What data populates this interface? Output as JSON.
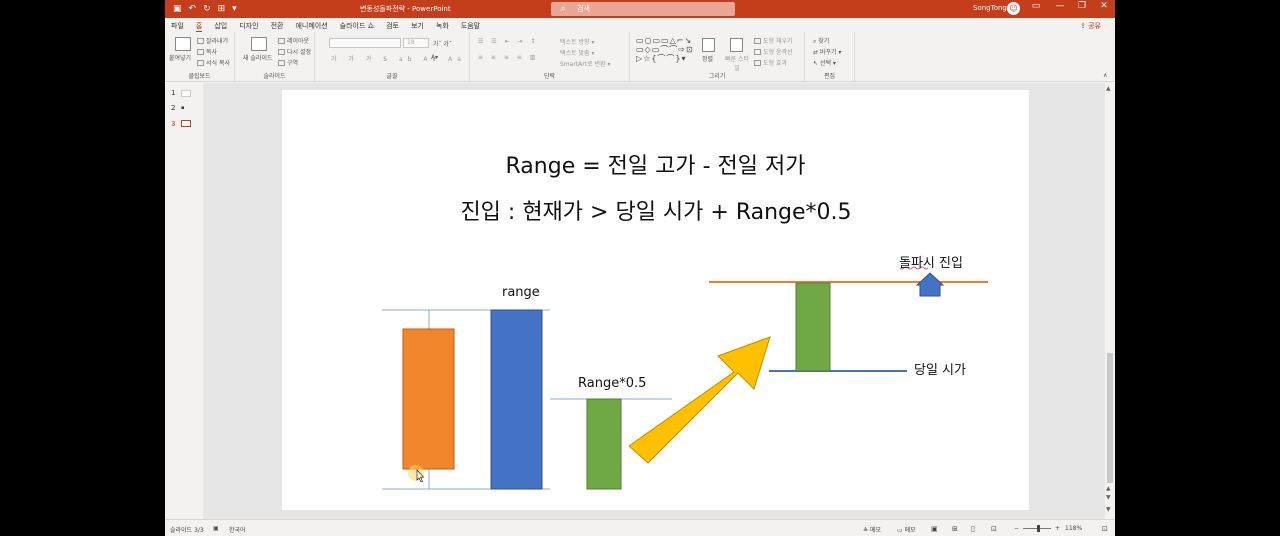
{
  "titlebar": {
    "doc_title": "변동성돌파전략  -  PowerPoint",
    "search_placeholder": "검색",
    "user_name": "SongTong",
    "avatar_initial": "☺",
    "minimize": "—",
    "restore": "❐",
    "close": "✕"
  },
  "tabs": [
    "파일",
    "홈",
    "삽입",
    "디자인",
    "전환",
    "애니메이션",
    "슬라이드 쇼",
    "검토",
    "보기",
    "녹화",
    "도움말"
  ],
  "active_tab": "홈",
  "share_label": "공유",
  "ribbon": {
    "clipboard": {
      "label": "클립보드",
      "paste": "붙여넣기",
      "cut": "잘라내기",
      "copy": "복사",
      "format_painter": "서식 복사"
    },
    "slides": {
      "label": "슬라이드",
      "new_slide": "새 슬라이드",
      "layout": "레이아웃",
      "reset": "다시 설정",
      "section": "구역"
    },
    "font": {
      "label": "글꼴",
      "font_size": "18"
    },
    "paragraph": {
      "label": "단락",
      "text_direction": "텍스트 방향",
      "align_text": "텍스트 맞춤",
      "smartart": "SmartArt로 변환"
    },
    "drawing": {
      "label": "그리기",
      "arrange": "정렬",
      "quick_styles": "빠른 스타일",
      "shape_fill": "도형 채우기",
      "shape_outline": "도형 윤곽선",
      "shape_effects": "도형 효과"
    },
    "editing": {
      "label": "편집",
      "find": "찾기",
      "replace": "바꾸기",
      "select": "선택"
    }
  },
  "thumbs": [
    {
      "num": "1"
    },
    {
      "num": "2"
    },
    {
      "num": "3"
    }
  ],
  "slide": {
    "title_line1": "Range = 전일 고가 - 전일 저가",
    "title_line2": "진입 : 현재가 > 당일 시가 + Range*0.5",
    "label_range": "range",
    "label_half": "Range*0.5",
    "label_breakout": "돌파시 진입",
    "label_open": "당일 시가"
  },
  "colors": {
    "orange_bar": "#f2862d",
    "blue_bar": "#4472c4",
    "green_bar": "#70a846",
    "arrow_fill": "#ffc000",
    "accent": "#c43e1c"
  },
  "status": {
    "slide_info": "슬라이드 3/3",
    "language": "한국어",
    "notes": "메모",
    "comments": "메모",
    "zoom": "118%"
  }
}
